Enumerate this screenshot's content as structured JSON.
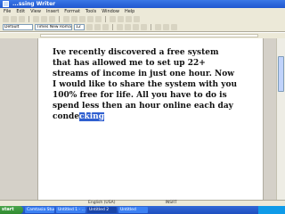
{
  "window": {
    "title": "...ssing Writer"
  },
  "menus": [
    "File",
    "Edit",
    "View",
    "Insert",
    "Format",
    "Tools",
    "Window",
    "Help"
  ],
  "toolbar": {
    "style_value": "Default",
    "font_value": "Times New Roman",
    "size_value": "12"
  },
  "document": {
    "text_before": "Ive recently discovered a free system that has allowed me to set up 22+ streams of income in just one hour. Now I would like to share the system with you 100% free for life. All you have to do is spend less then an hour online each day conde",
    "selected": "cking"
  },
  "statusbar": {
    "page": "",
    "language": "English (USA)",
    "mode": "INSRT"
  },
  "taskbar": {
    "start_label": "start",
    "tasks": [
      "Camtasia Studio",
      "Untitled 1 - ...",
      "Untitled 2",
      "Untitled"
    ]
  }
}
